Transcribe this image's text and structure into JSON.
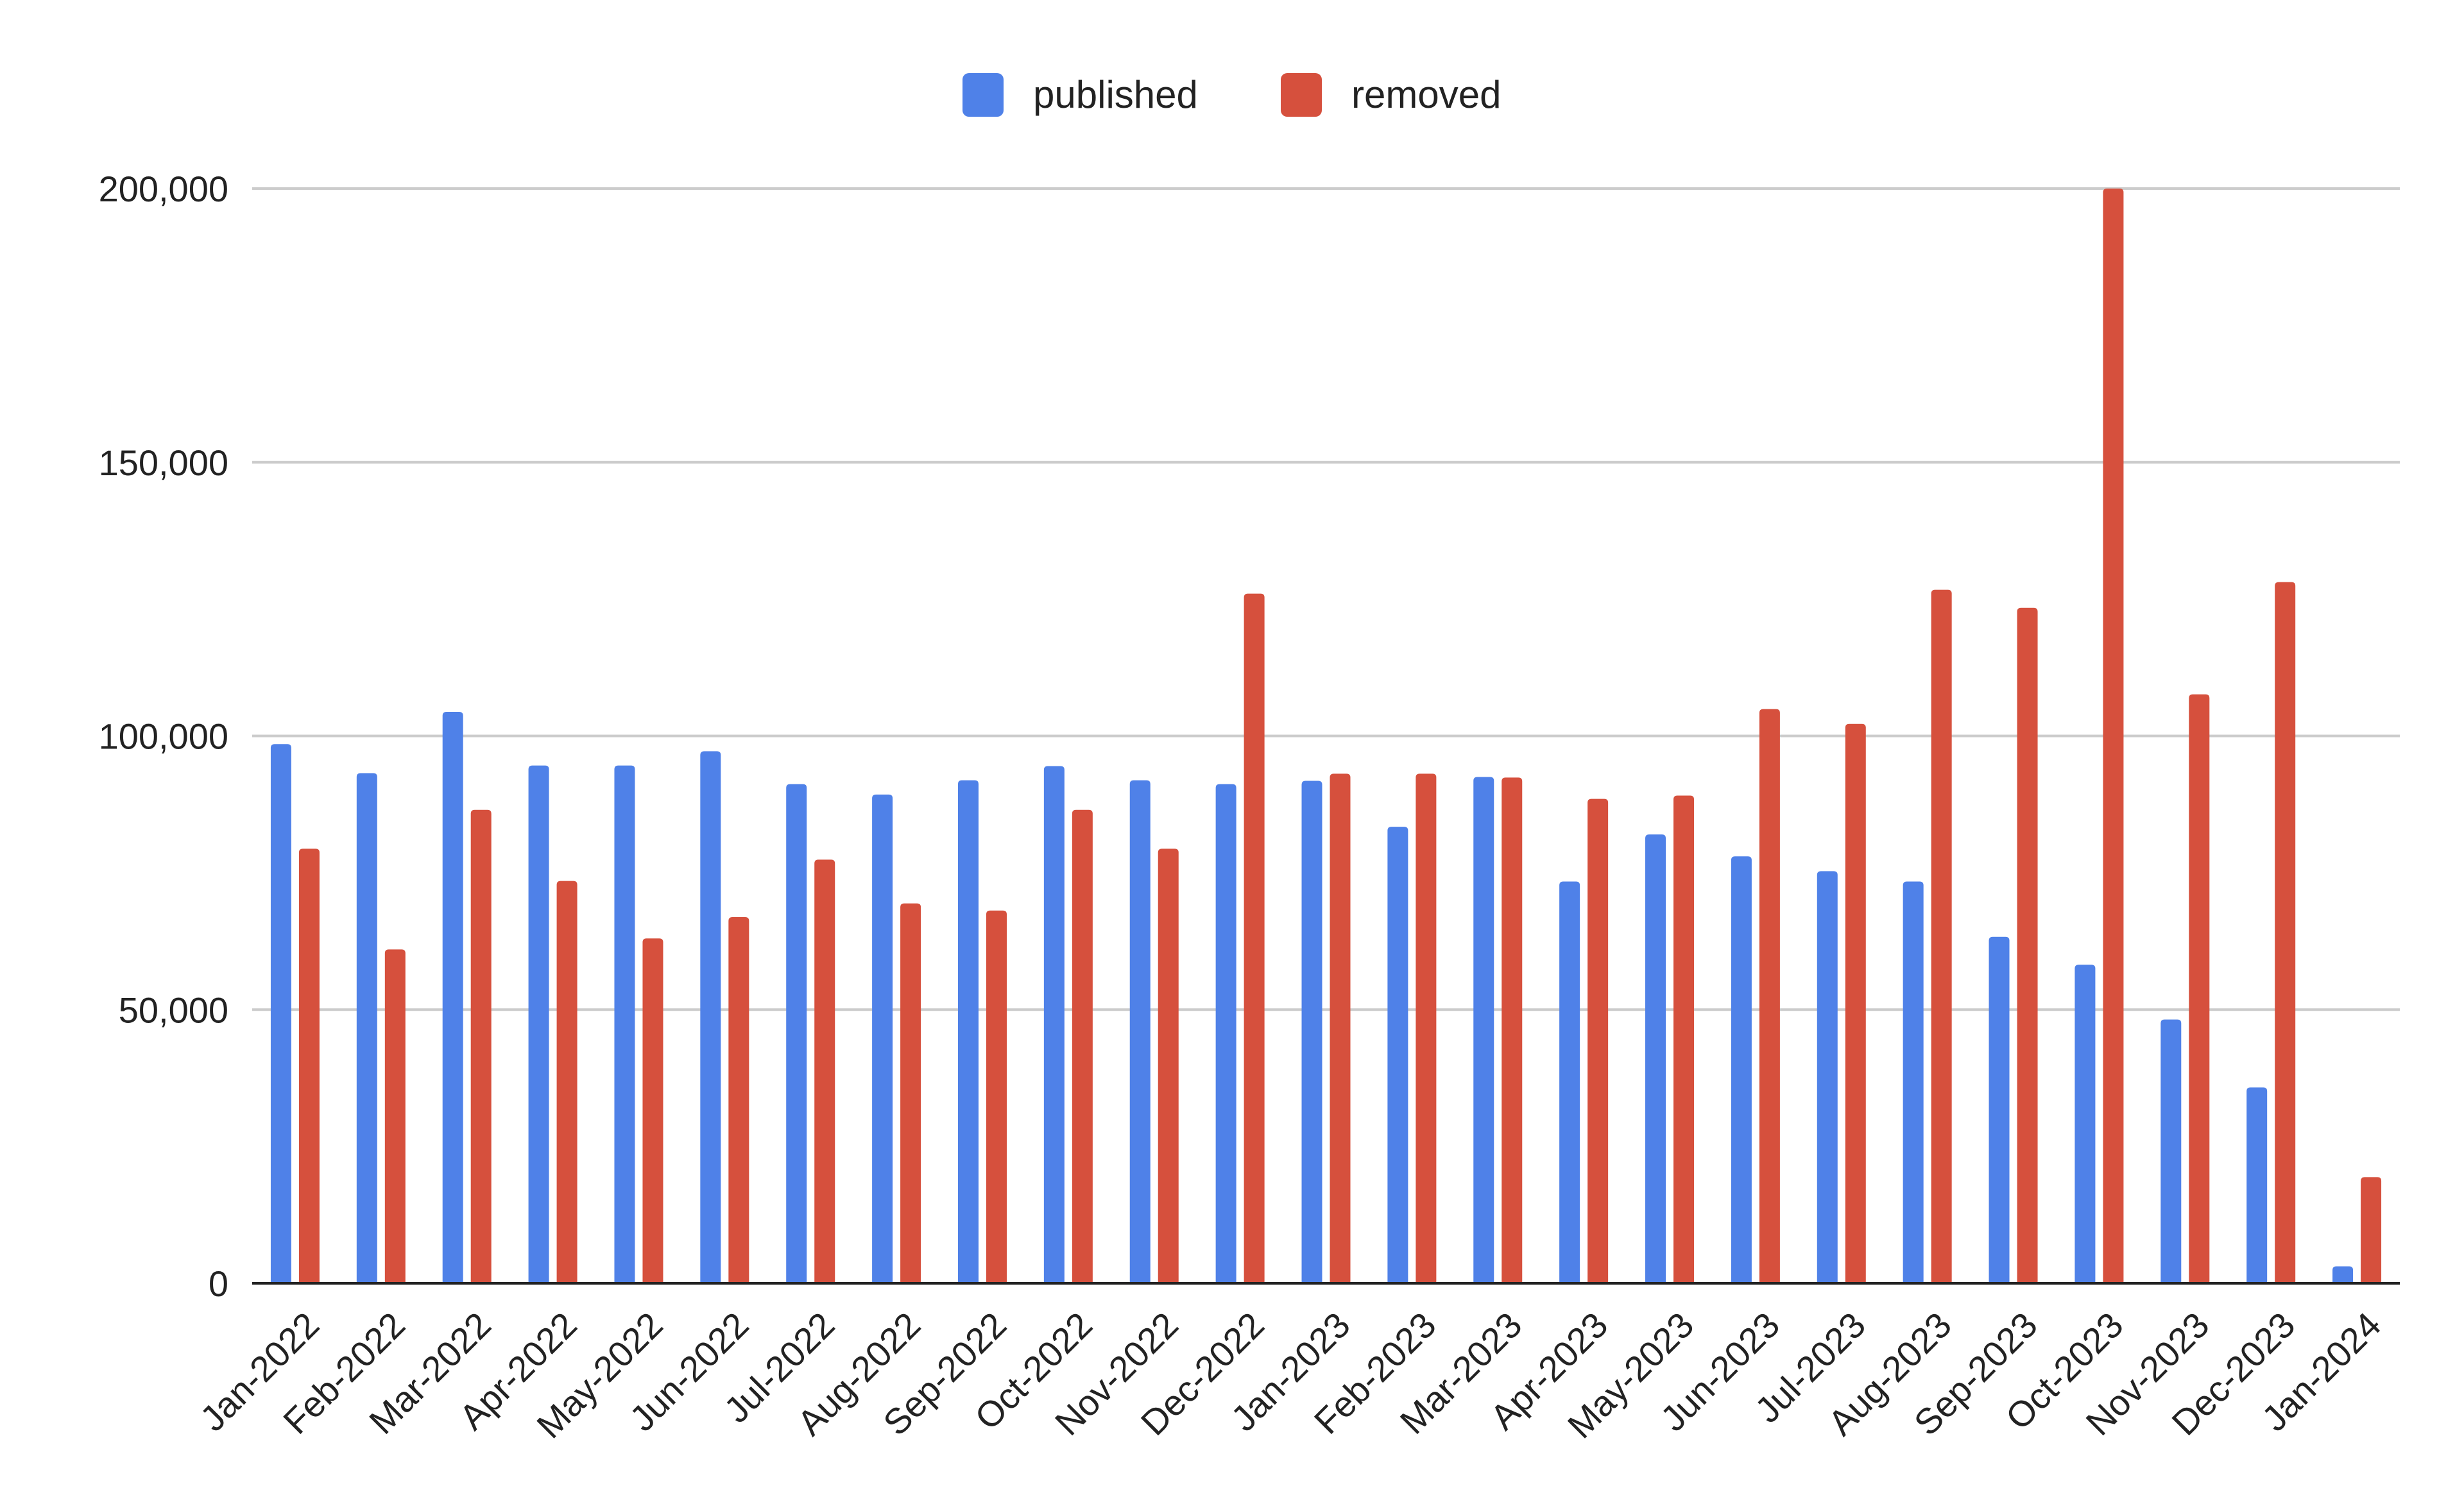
{
  "chart_data": {
    "type": "bar",
    "title": "",
    "xlabel": "",
    "ylabel": "",
    "ylim": [
      0,
      200000
    ],
    "yticks": [
      0,
      50000,
      100000,
      150000,
      200000
    ],
    "ytick_labels": [
      "0",
      "50,000",
      "100,000",
      "150,000",
      "200,000"
    ],
    "grid": true,
    "legend_position": "top",
    "categories": [
      "Jan-2022",
      "Feb-2022",
      "Mar-2022",
      "Apr-2022",
      "May-2022",
      "Jun-2022",
      "Jul-2022",
      "Aug-2022",
      "Sep-2022",
      "Oct-2022",
      "Nov-2022",
      "Dec-2022",
      "Jan-2023",
      "Feb-2023",
      "Mar-2023",
      "Apr-2023",
      "May-2023",
      "Jun-2023",
      "Jul-2023",
      "Aug-2023",
      "Sep-2023",
      "Oct-2023",
      "Nov-2023",
      "Dec-2023",
      "Jan-2024"
    ],
    "series": [
      {
        "name": "published",
        "color": "#4f81e8",
        "values": [
          98500,
          93200,
          104400,
          94600,
          94600,
          97200,
          91200,
          89300,
          91900,
          94500,
          91900,
          91200,
          91800,
          83400,
          92500,
          73400,
          82000,
          78000,
          75300,
          73400,
          63300,
          58200,
          48200,
          35800,
          3100
        ]
      },
      {
        "name": "removed",
        "color": "#d6503d",
        "values": [
          79400,
          61000,
          86500,
          73500,
          63000,
          66900,
          77400,
          69400,
          68100,
          86500,
          79400,
          126000,
          93100,
          93100,
          92400,
          88500,
          89100,
          104900,
          102200,
          126700,
          123400,
          200000,
          107600,
          128100,
          19400
        ]
      }
    ]
  }
}
